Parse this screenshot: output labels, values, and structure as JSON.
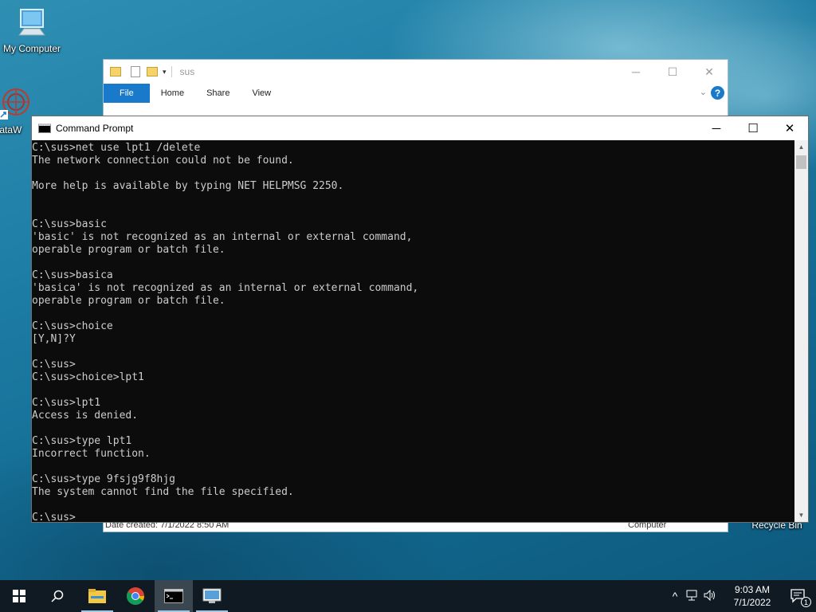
{
  "desktop": {
    "icons": [
      {
        "label": "My Computer"
      },
      {
        "label": "DataW"
      },
      {
        "label": "Recycle Bin"
      }
    ]
  },
  "explorer": {
    "title": "sus",
    "tabs": [
      "File",
      "Home",
      "Share",
      "View"
    ],
    "status_left": "Date created: 7/1/2022 8:50 AM",
    "status_right": "Computer"
  },
  "cmd": {
    "title": "Command Prompt",
    "lines": [
      "C:\\sus>net use lpt1 /delete",
      "The network connection could not be found.",
      "",
      "More help is available by typing NET HELPMSG 2250.",
      "",
      "",
      "C:\\sus>basic",
      "'basic' is not recognized as an internal or external command,",
      "operable program or batch file.",
      "",
      "C:\\sus>basica",
      "'basica' is not recognized as an internal or external command,",
      "operable program or batch file.",
      "",
      "C:\\sus>choice",
      "[Y,N]?Y",
      "",
      "C:\\sus>",
      "C:\\sus>choice>lpt1",
      "",
      "C:\\sus>lpt1",
      "Access is denied.",
      "",
      "C:\\sus>type lpt1",
      "Incorrect function.",
      "",
      "C:\\sus>type 9fsjg9f8hjg",
      "The system cannot find the file specified.",
      "",
      "C:\\sus>"
    ]
  },
  "taskbar": {
    "time": "9:03 AM",
    "date": "7/1/2022",
    "notification_count": "1"
  }
}
